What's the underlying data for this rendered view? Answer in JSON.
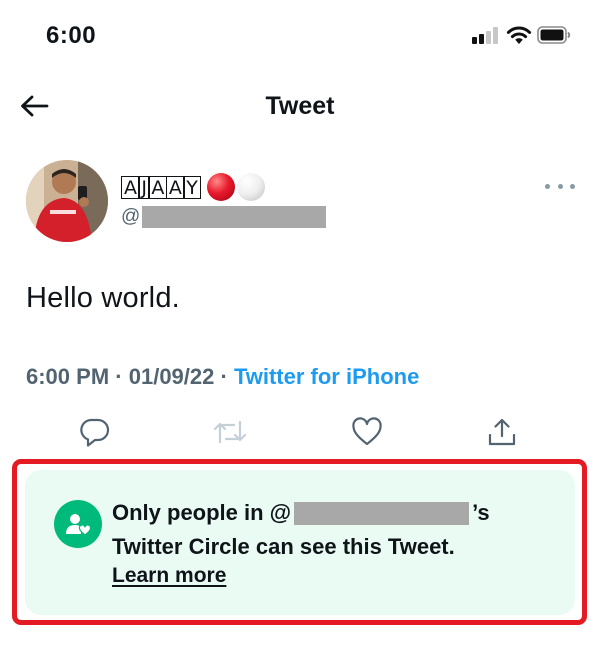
{
  "status_bar": {
    "time": "6:00",
    "signal_icon": "cellular-signal-icon",
    "wifi_icon": "wifi-icon",
    "battery_icon": "battery-icon"
  },
  "nav": {
    "back_icon": "arrow-left-icon",
    "title": "Tweet"
  },
  "author": {
    "display_name_letters": [
      "A",
      "J",
      "A",
      "A",
      "Y"
    ],
    "name_emoji": [
      "red-circle",
      "white-circle"
    ],
    "handle_prefix": "@",
    "handle_redacted": true,
    "more_icon": "more-horizontal-icon"
  },
  "tweet": {
    "text": "Hello world.",
    "time": "6:00 PM",
    "separator": "·",
    "date": "01/09/22",
    "source": "Twitter for iPhone"
  },
  "actions": [
    {
      "name": "reply",
      "icon": "reply-icon",
      "enabled": true
    },
    {
      "name": "retweet",
      "icon": "retweet-icon",
      "enabled": false
    },
    {
      "name": "like",
      "icon": "heart-icon",
      "enabled": true
    },
    {
      "name": "share",
      "icon": "share-icon",
      "enabled": true
    }
  ],
  "circle_notice": {
    "icon": "twitter-circle-icon",
    "line1_prefix": "Only people in @",
    "line1_suffix": "’s",
    "line2": "Twitter Circle can see this Tweet.",
    "learn_more": "Learn more"
  },
  "colors": {
    "accent_blue": "#1d9bf0",
    "circle_green": "#00ba7c",
    "notice_bg": "#eafbf4",
    "highlight_red": "#e41b23",
    "secondary_text": "#536471"
  }
}
